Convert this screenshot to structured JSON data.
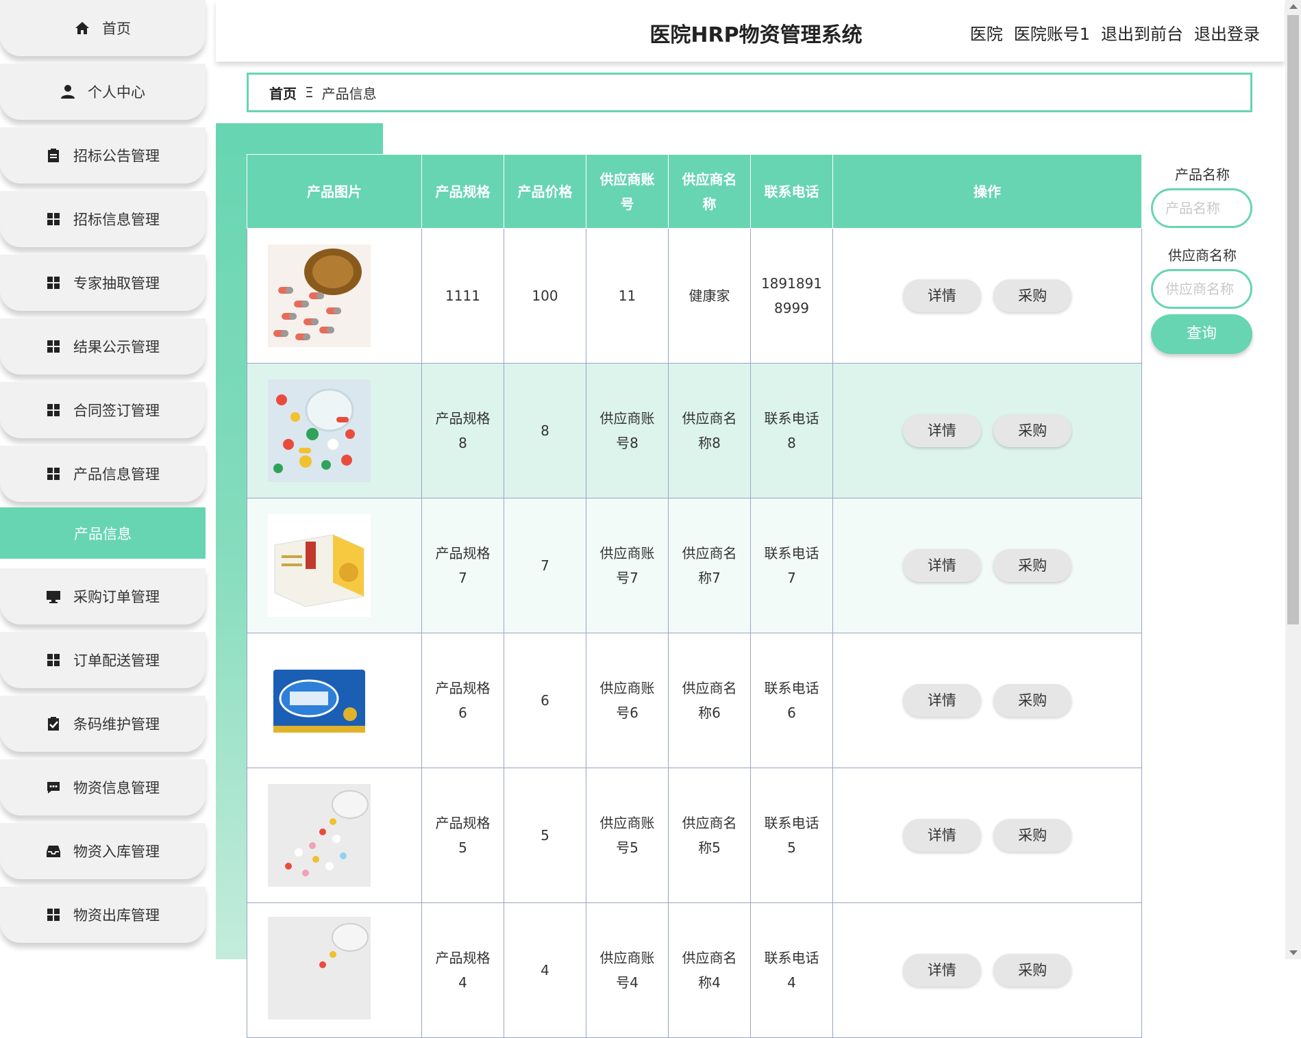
{
  "app_title": "医院HRP物资管理系统",
  "header_links": {
    "role": "医院",
    "account": "医院账号1",
    "front": "退出到前台",
    "logout": "退出登录"
  },
  "sidebar": {
    "items": [
      {
        "label": "首页",
        "icon": "home-icon"
      },
      {
        "label": "个人中心",
        "icon": "user-icon"
      },
      {
        "label": "招标公告管理",
        "icon": "clipboard-icon"
      },
      {
        "label": "招标信息管理",
        "icon": "grid-icon"
      },
      {
        "label": "专家抽取管理",
        "icon": "grid-icon"
      },
      {
        "label": "结果公示管理",
        "icon": "grid-icon"
      },
      {
        "label": "合同签订管理",
        "icon": "grid-icon"
      },
      {
        "label": "产品信息管理",
        "icon": "grid-icon"
      }
    ],
    "sub_item": "产品信息",
    "items_after": [
      {
        "label": "采购订单管理",
        "icon": "monitor-icon"
      },
      {
        "label": "订单配送管理",
        "icon": "grid-icon"
      },
      {
        "label": "条码维护管理",
        "icon": "clipboard-check-icon"
      },
      {
        "label": "物资信息管理",
        "icon": "chat-icon"
      },
      {
        "label": "物资入库管理",
        "icon": "inbox-icon"
      },
      {
        "label": "物资出库管理",
        "icon": "grid-icon"
      }
    ]
  },
  "breadcrumb": {
    "home": "首页",
    "separator": "Ξ",
    "current": "产品信息"
  },
  "table": {
    "headers": [
      "产品图片",
      "产品规格",
      "产品价格",
      "供应商账号",
      "供应商名称",
      "联系电话",
      "操作"
    ],
    "rows": [
      {
        "spec": "1111",
        "price": "100",
        "account": "11",
        "supplier": "健康家",
        "phone": "18918918999"
      },
      {
        "spec": "产品规格8",
        "price": "8",
        "account": "供应商账号8",
        "supplier": "供应商名称8",
        "phone": "联系电话8"
      },
      {
        "spec": "产品规格7",
        "price": "7",
        "account": "供应商账号7",
        "supplier": "供应商名称7",
        "phone": "联系电话7"
      },
      {
        "spec": "产品规格6",
        "price": "6",
        "account": "供应商账号6",
        "supplier": "供应商名称6",
        "phone": "联系电话6"
      },
      {
        "spec": "产品规格5",
        "price": "5",
        "account": "供应商账号5",
        "supplier": "供应商名称5",
        "phone": "联系电话5"
      },
      {
        "spec": "产品规格4",
        "price": "4",
        "account": "供应商账号4",
        "supplier": "供应商名称4",
        "phone": "联系电话4"
      }
    ],
    "detail_label": "详情",
    "buy_label": "采购"
  },
  "search": {
    "product_label": "产品名称",
    "product_placeholder": "产品名称",
    "supplier_label": "供应商名称",
    "supplier_placeholder": "供应商名称",
    "query_label": "查询"
  },
  "colors": {
    "accent": "#67d5b1",
    "row_alt": "#ddf4ec",
    "button": "#e6e6e6"
  }
}
